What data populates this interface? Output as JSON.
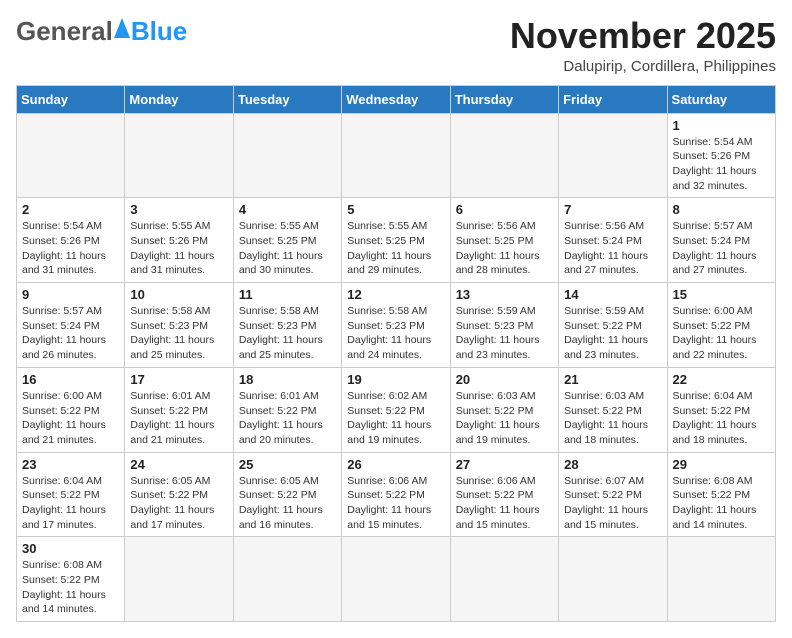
{
  "header": {
    "logo_general": "General",
    "logo_blue": "Blue",
    "logo_tagline": "",
    "month_title": "November 2025",
    "location": "Dalupirip, Cordillera, Philippines"
  },
  "weekdays": [
    "Sunday",
    "Monday",
    "Tuesday",
    "Wednesday",
    "Thursday",
    "Friday",
    "Saturday"
  ],
  "weeks": [
    [
      {
        "day": "",
        "info": ""
      },
      {
        "day": "",
        "info": ""
      },
      {
        "day": "",
        "info": ""
      },
      {
        "day": "",
        "info": ""
      },
      {
        "day": "",
        "info": ""
      },
      {
        "day": "",
        "info": ""
      },
      {
        "day": "1",
        "info": "Sunrise: 5:54 AM\nSunset: 5:26 PM\nDaylight: 11 hours\nand 32 minutes."
      }
    ],
    [
      {
        "day": "2",
        "info": "Sunrise: 5:54 AM\nSunset: 5:26 PM\nDaylight: 11 hours\nand 31 minutes."
      },
      {
        "day": "3",
        "info": "Sunrise: 5:55 AM\nSunset: 5:26 PM\nDaylight: 11 hours\nand 31 minutes."
      },
      {
        "day": "4",
        "info": "Sunrise: 5:55 AM\nSunset: 5:25 PM\nDaylight: 11 hours\nand 30 minutes."
      },
      {
        "day": "5",
        "info": "Sunrise: 5:55 AM\nSunset: 5:25 PM\nDaylight: 11 hours\nand 29 minutes."
      },
      {
        "day": "6",
        "info": "Sunrise: 5:56 AM\nSunset: 5:25 PM\nDaylight: 11 hours\nand 28 minutes."
      },
      {
        "day": "7",
        "info": "Sunrise: 5:56 AM\nSunset: 5:24 PM\nDaylight: 11 hours\nand 27 minutes."
      },
      {
        "day": "8",
        "info": "Sunrise: 5:57 AM\nSunset: 5:24 PM\nDaylight: 11 hours\nand 27 minutes."
      }
    ],
    [
      {
        "day": "9",
        "info": "Sunrise: 5:57 AM\nSunset: 5:24 PM\nDaylight: 11 hours\nand 26 minutes."
      },
      {
        "day": "10",
        "info": "Sunrise: 5:58 AM\nSunset: 5:23 PM\nDaylight: 11 hours\nand 25 minutes."
      },
      {
        "day": "11",
        "info": "Sunrise: 5:58 AM\nSunset: 5:23 PM\nDaylight: 11 hours\nand 25 minutes."
      },
      {
        "day": "12",
        "info": "Sunrise: 5:58 AM\nSunset: 5:23 PM\nDaylight: 11 hours\nand 24 minutes."
      },
      {
        "day": "13",
        "info": "Sunrise: 5:59 AM\nSunset: 5:23 PM\nDaylight: 11 hours\nand 23 minutes."
      },
      {
        "day": "14",
        "info": "Sunrise: 5:59 AM\nSunset: 5:22 PM\nDaylight: 11 hours\nand 23 minutes."
      },
      {
        "day": "15",
        "info": "Sunrise: 6:00 AM\nSunset: 5:22 PM\nDaylight: 11 hours\nand 22 minutes."
      }
    ],
    [
      {
        "day": "16",
        "info": "Sunrise: 6:00 AM\nSunset: 5:22 PM\nDaylight: 11 hours\nand 21 minutes."
      },
      {
        "day": "17",
        "info": "Sunrise: 6:01 AM\nSunset: 5:22 PM\nDaylight: 11 hours\nand 21 minutes."
      },
      {
        "day": "18",
        "info": "Sunrise: 6:01 AM\nSunset: 5:22 PM\nDaylight: 11 hours\nand 20 minutes."
      },
      {
        "day": "19",
        "info": "Sunrise: 6:02 AM\nSunset: 5:22 PM\nDaylight: 11 hours\nand 19 minutes."
      },
      {
        "day": "20",
        "info": "Sunrise: 6:03 AM\nSunset: 5:22 PM\nDaylight: 11 hours\nand 19 minutes."
      },
      {
        "day": "21",
        "info": "Sunrise: 6:03 AM\nSunset: 5:22 PM\nDaylight: 11 hours\nand 18 minutes."
      },
      {
        "day": "22",
        "info": "Sunrise: 6:04 AM\nSunset: 5:22 PM\nDaylight: 11 hours\nand 18 minutes."
      }
    ],
    [
      {
        "day": "23",
        "info": "Sunrise: 6:04 AM\nSunset: 5:22 PM\nDaylight: 11 hours\nand 17 minutes."
      },
      {
        "day": "24",
        "info": "Sunrise: 6:05 AM\nSunset: 5:22 PM\nDaylight: 11 hours\nand 17 minutes."
      },
      {
        "day": "25",
        "info": "Sunrise: 6:05 AM\nSunset: 5:22 PM\nDaylight: 11 hours\nand 16 minutes."
      },
      {
        "day": "26",
        "info": "Sunrise: 6:06 AM\nSunset: 5:22 PM\nDaylight: 11 hours\nand 15 minutes."
      },
      {
        "day": "27",
        "info": "Sunrise: 6:06 AM\nSunset: 5:22 PM\nDaylight: 11 hours\nand 15 minutes."
      },
      {
        "day": "28",
        "info": "Sunrise: 6:07 AM\nSunset: 5:22 PM\nDaylight: 11 hours\nand 15 minutes."
      },
      {
        "day": "29",
        "info": "Sunrise: 6:08 AM\nSunset: 5:22 PM\nDaylight: 11 hours\nand 14 minutes."
      }
    ],
    [
      {
        "day": "30",
        "info": "Sunrise: 6:08 AM\nSunset: 5:22 PM\nDaylight: 11 hours\nand 14 minutes."
      },
      {
        "day": "",
        "info": ""
      },
      {
        "day": "",
        "info": ""
      },
      {
        "day": "",
        "info": ""
      },
      {
        "day": "",
        "info": ""
      },
      {
        "day": "",
        "info": ""
      },
      {
        "day": "",
        "info": ""
      }
    ]
  ]
}
